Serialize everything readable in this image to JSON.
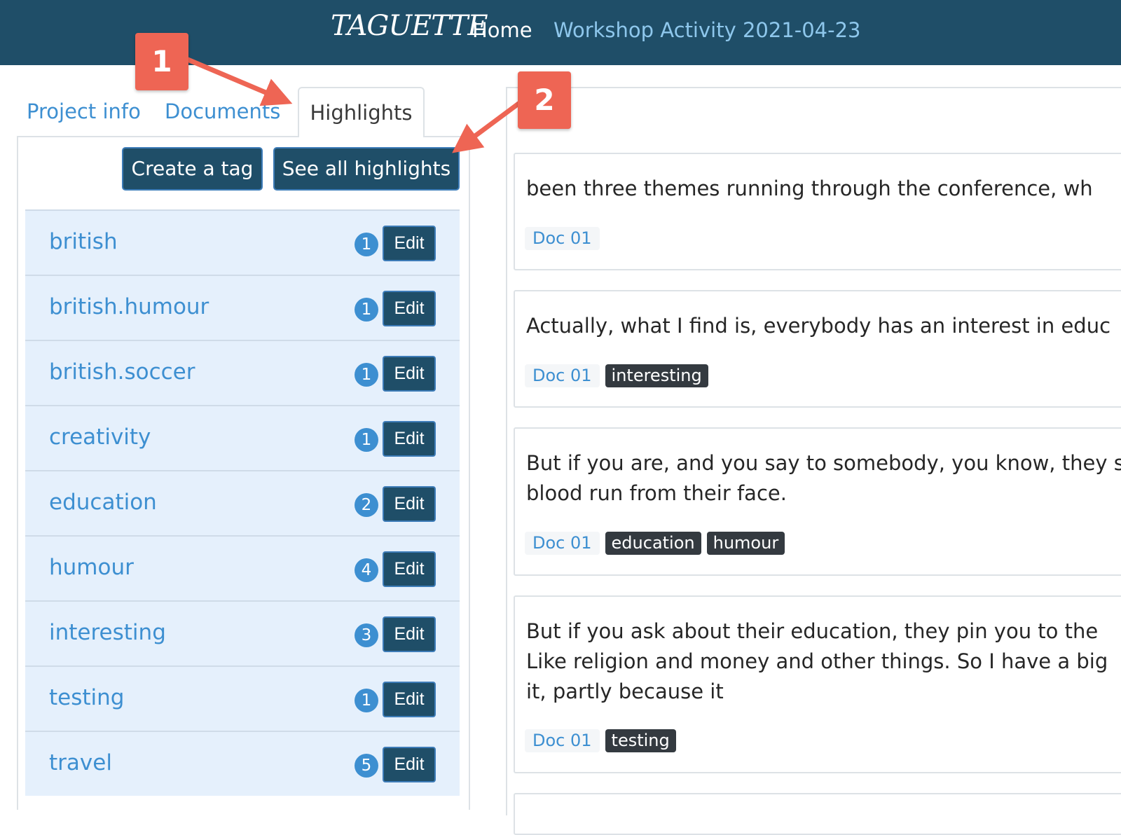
{
  "navbar": {
    "brand": "TAGUETTE",
    "home": "Home",
    "project": "Workshop Activity 2021-04-23"
  },
  "tabs": [
    {
      "label": "Project info",
      "active": false
    },
    {
      "label": "Documents",
      "active": false
    },
    {
      "label": "Highlights",
      "active": true
    }
  ],
  "buttons": {
    "create_tag": "Create a tag",
    "see_all": "See all highlights"
  },
  "tags": [
    {
      "name": "british",
      "count": "1",
      "edit": "Edit"
    },
    {
      "name": "british.humour",
      "count": "1",
      "edit": "Edit"
    },
    {
      "name": "british.soccer",
      "count": "1",
      "edit": "Edit"
    },
    {
      "name": "creativity",
      "count": "1",
      "edit": "Edit"
    },
    {
      "name": "education",
      "count": "2",
      "edit": "Edit"
    },
    {
      "name": "humour",
      "count": "4",
      "edit": "Edit"
    },
    {
      "name": "interesting",
      "count": "3",
      "edit": "Edit"
    },
    {
      "name": "testing",
      "count": "1",
      "edit": "Edit"
    },
    {
      "name": "travel",
      "count": "5",
      "edit": "Edit"
    }
  ],
  "highlights": [
    {
      "text": "been three themes running through the conference, wh",
      "doc": "Doc 01",
      "tags": []
    },
    {
      "text": "Actually, what I find is, everybody has an interest in educ",
      "doc": "Doc 01",
      "tags": [
        "interesting"
      ]
    },
    {
      "text": "But if you are, and you say to somebody, you know, they s\nblood run from their face.",
      "doc": "Doc 01",
      "tags": [
        "education",
        "humour"
      ]
    },
    {
      "text": "But if you ask about their education, they pin you to the \nLike religion and money and other things. So I have a big\nit, partly because it",
      "doc": "Doc 01",
      "tags": [
        "testing"
      ]
    }
  ],
  "callouts": {
    "one": "1",
    "two": "2"
  },
  "colors": {
    "navbar": "#1f4e68",
    "link": "#3d8fd1",
    "tag_row": "#e5f0fc",
    "callout": "#ee6554",
    "tag_pill": "#343a40"
  }
}
